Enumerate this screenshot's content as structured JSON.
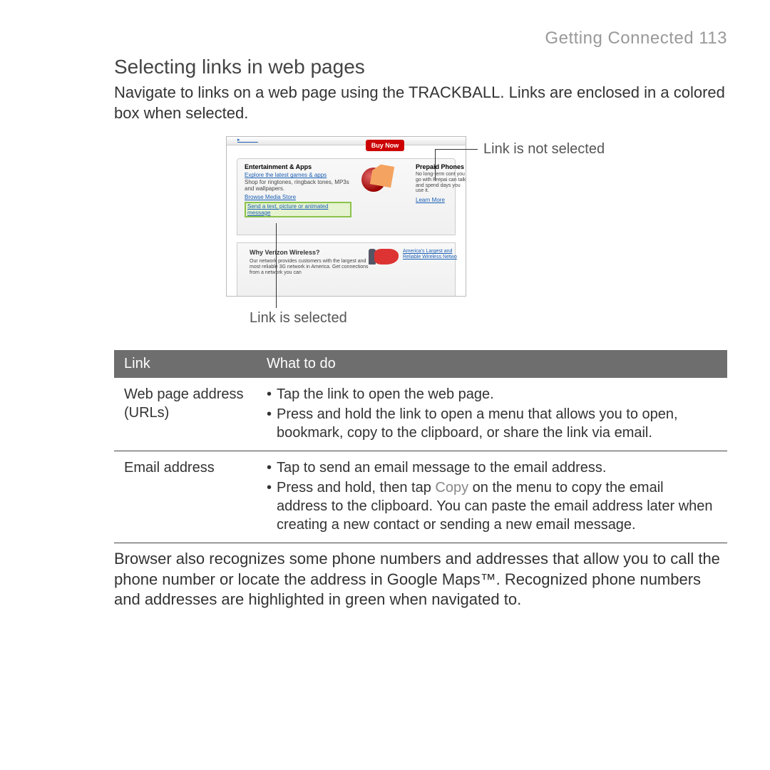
{
  "header": {
    "chapter": "Getting Connected",
    "page": "113"
  },
  "title": "Selecting links in web pages",
  "intro": "Navigate to links on a web page using the TRACKBALL. Links are enclosed in a colored box when selected.",
  "figure": {
    "buy_now": "Buy Now",
    "ent_heading": "Entertainment & Apps",
    "ent_link1": "Explore the latest games & apps",
    "ent_text": "Shop for ringtones, ringback tones, MP3s and wallpapers.",
    "ent_link2": "Browse Media Store",
    "ent_selected": "Send a text, picture or animated message",
    "pre_heading": "Prepaid Phones",
    "pre_text": "No long-term cont you go with Prepai can talk and spend days you use it.",
    "pre_link": "Learn More",
    "why_heading": "Why Verizon Wireless?",
    "why_text": "Our network provides customers with the largest and most reliable 3G network in America. Get connections from a network you can",
    "why_link": "America's Largest and Reliable Wireless Netwo",
    "label_not_selected": "Link is not selected",
    "label_selected": "Link is selected"
  },
  "table": {
    "col1": "Link",
    "col2": "What to do",
    "rows": [
      {
        "link": "Web page address (URLs)",
        "actions": [
          "Tap the link to open the web page.",
          "Press and hold the link to open a menu that allows you to open, bookmark, copy to the clipboard, or share the link via email."
        ]
      },
      {
        "link": "Email address",
        "actions": [
          "Tap to send an email message to the email address.",
          "Press and hold, then tap Copy on the menu to copy the email address to the clipboard. You can paste the email address later when creating a new contact or sending a new email message."
        ],
        "menu_word": "Copy"
      }
    ]
  },
  "outro": "Browser also recognizes some phone numbers and addresses that allow you to call the phone number or locate the address in Google Maps™. Recognized phone numbers and addresses are highlighted in green when navigated to."
}
